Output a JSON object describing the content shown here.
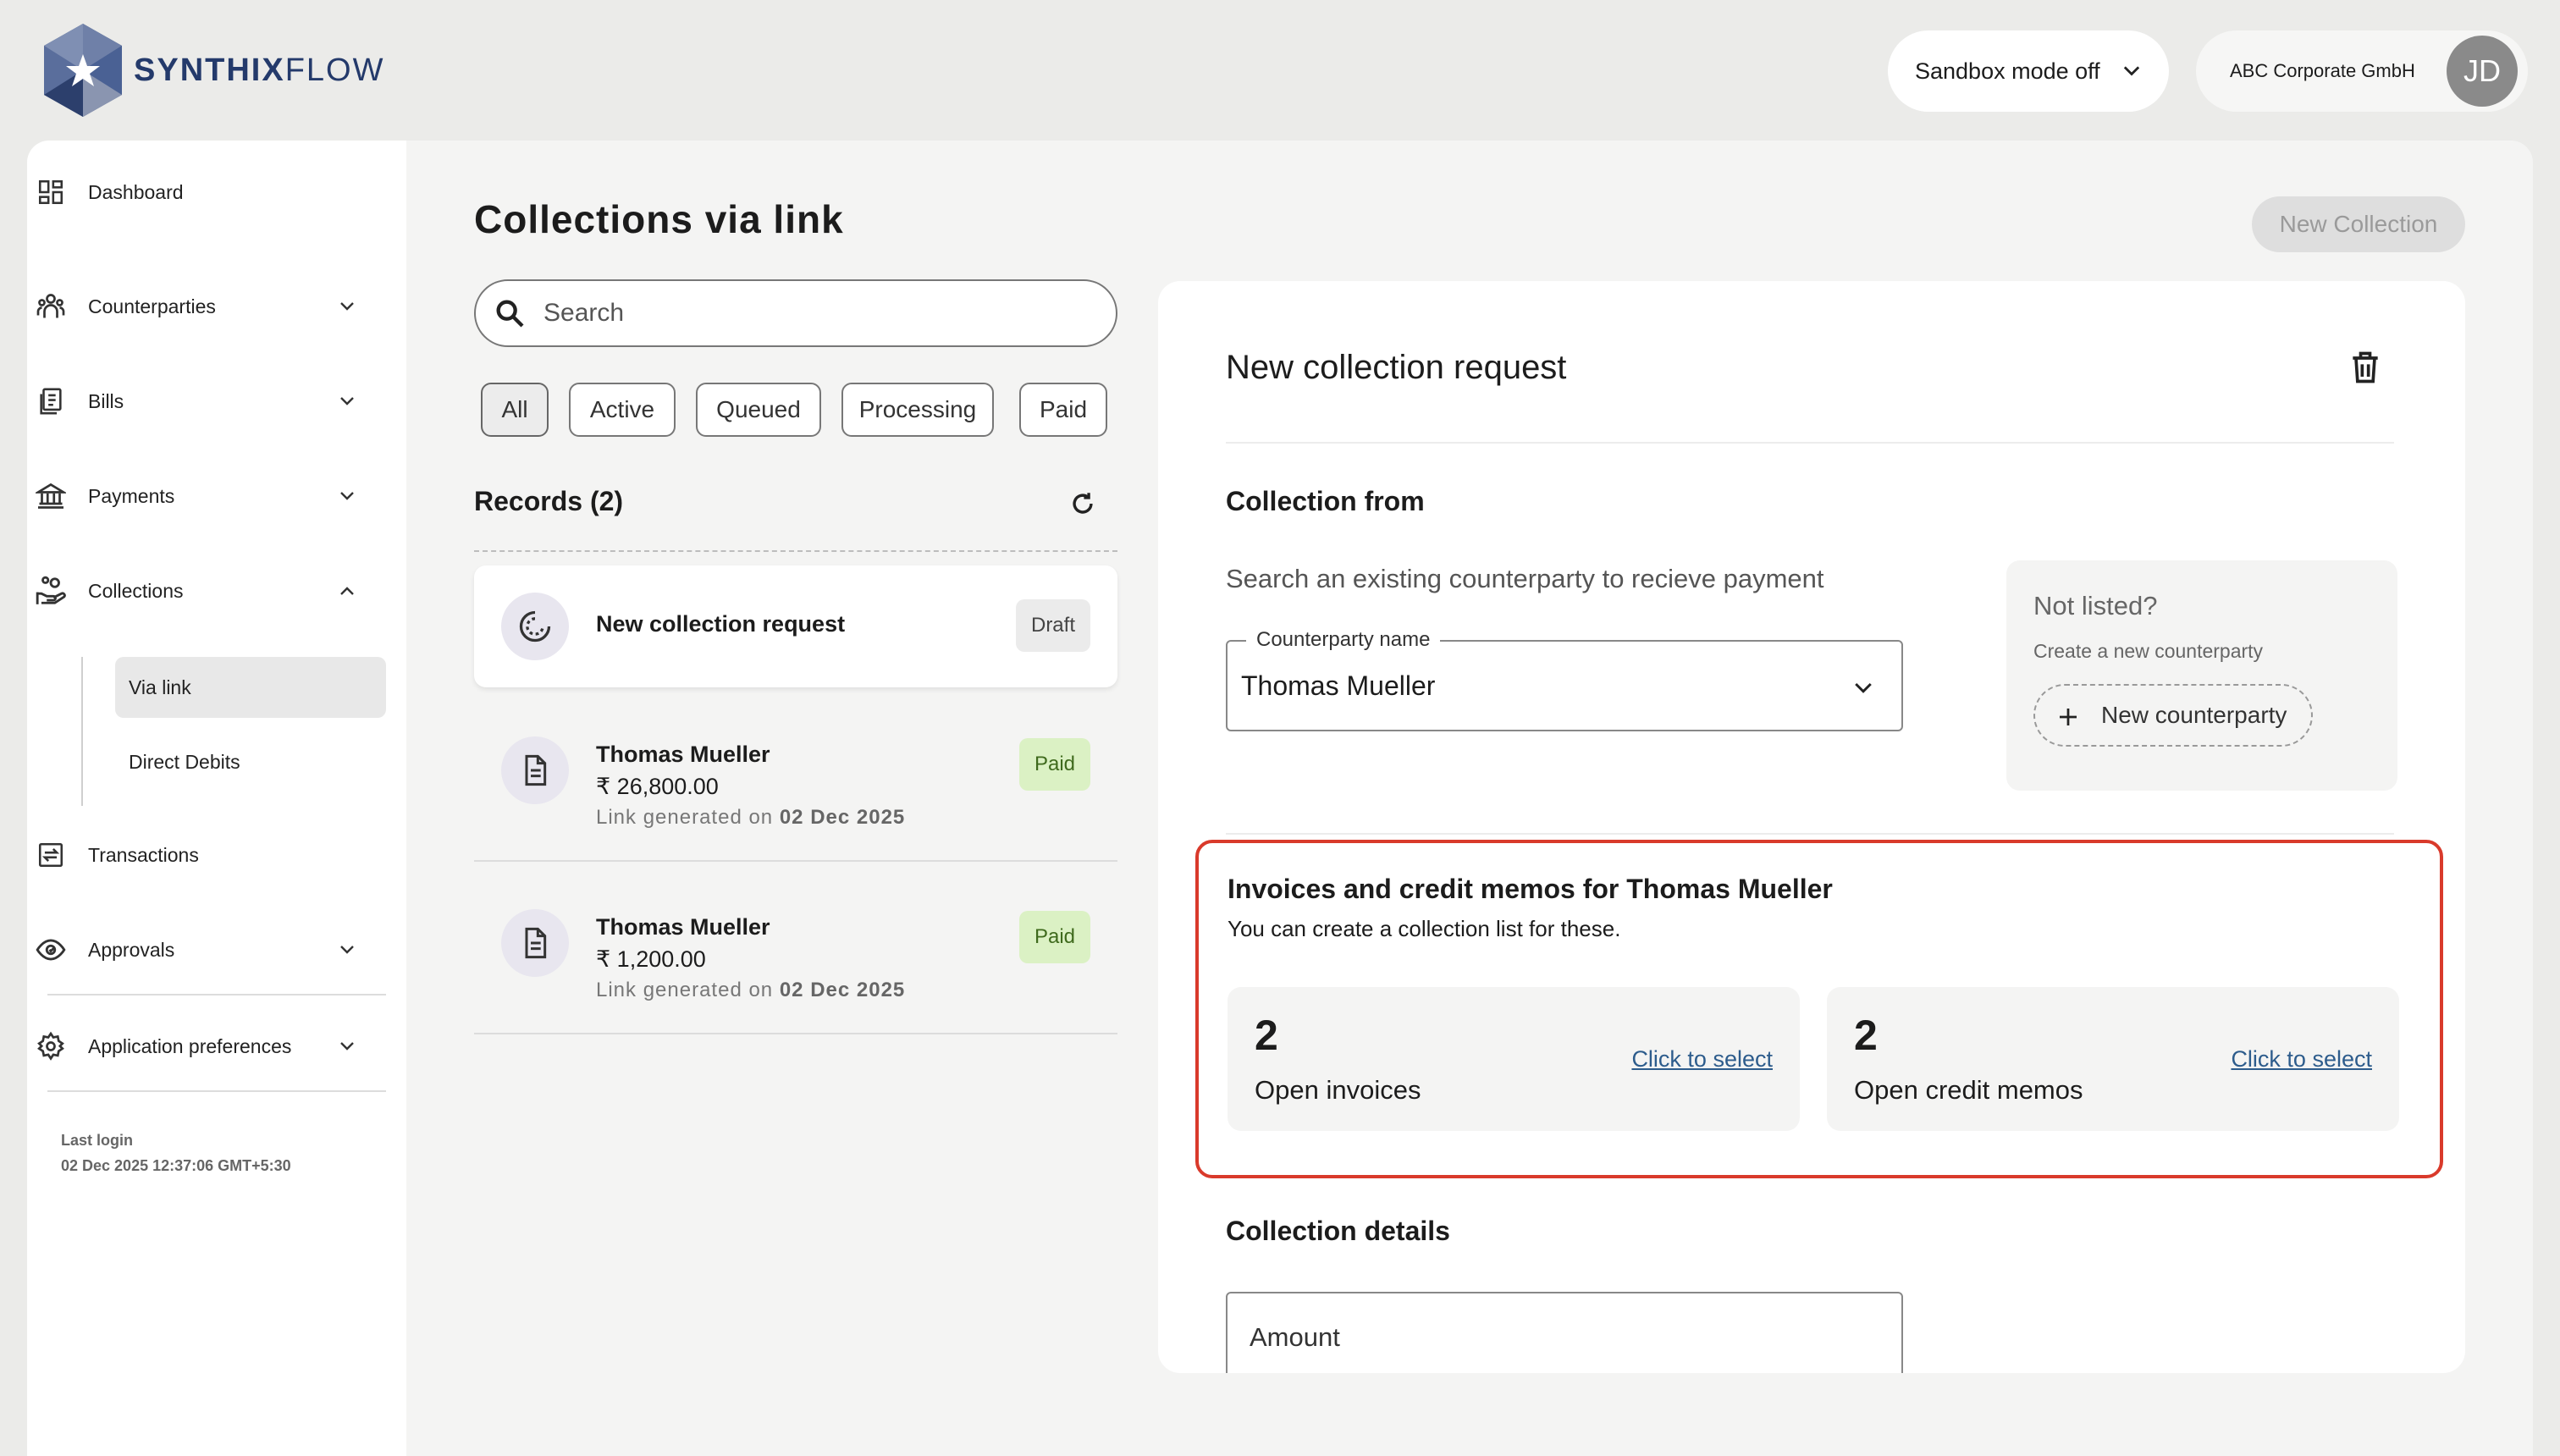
{
  "brand": {
    "name_bold": "SYNTHIX",
    "name_light": "FLOW"
  },
  "header": {
    "sandbox_label": "Sandbox mode off",
    "org_name": "ABC Corporate GmbH",
    "avatar_initials": "JD"
  },
  "sidebar": {
    "items": [
      {
        "label": "Dashboard",
        "icon": "dashboard-icon"
      },
      {
        "label": "Counterparties",
        "icon": "people-icon",
        "expandable": true
      },
      {
        "label": "Bills",
        "icon": "bills-icon",
        "expandable": true
      },
      {
        "label": "Payments",
        "icon": "bank-icon",
        "expandable": true
      },
      {
        "label": "Collections",
        "icon": "hand-coins-icon",
        "expanded": true
      },
      {
        "label": "Transactions",
        "icon": "transfer-icon"
      },
      {
        "label": "Approvals",
        "icon": "eye-icon",
        "expandable": true
      },
      {
        "label": "Application preferences",
        "icon": "gear-icon",
        "expandable": true
      }
    ],
    "sub_items": [
      {
        "label": "Via link",
        "active": true
      },
      {
        "label": "Direct Debits",
        "active": false
      }
    ],
    "last_login_label": "Last login",
    "last_login_value": "02 Dec 2025 12:37:06 GMT+5:30"
  },
  "page": {
    "title": "Collections via link",
    "new_collection_label": "New Collection",
    "search_placeholder": "Search",
    "filters": [
      "All",
      "Active",
      "Queued",
      "Processing",
      "Paid"
    ],
    "active_filter": "All",
    "records_title": "Records (2)"
  },
  "records": [
    {
      "name": "New collection request",
      "status": "Draft"
    },
    {
      "name": "Thomas Mueller",
      "amount": "₹ 26,800.00",
      "link_prefix": "Link generated on",
      "date": "02 Dec 2025",
      "status": "Paid"
    },
    {
      "name": "Thomas Mueller",
      "amount": "₹ 1,200.00",
      "link_prefix": "Link generated on",
      "date": "02 Dec 2025",
      "status": "Paid"
    }
  ],
  "form": {
    "title": "New collection request",
    "collection_from_title": "Collection from",
    "hint": "Search an existing counterparty to recieve payment",
    "counterparty_label": "Counterparty name",
    "counterparty_value": "Thomas Mueller",
    "not_listed_title": "Not listed?",
    "not_listed_sub": "Create a new counterparty",
    "new_counterparty_label": "New counterparty",
    "invoices_title": "Invoices and credit memos for Thomas Mueller",
    "invoices_sub": "You can create a collection list for these.",
    "open_invoices_count": "2",
    "open_invoices_label": "Open invoices",
    "open_credit_count": "2",
    "open_credit_label": "Open credit memos",
    "select_link_label": "Click to select",
    "details_title": "Collection details",
    "amount_label": "Amount"
  },
  "colors": {
    "brand": "#243a6b",
    "highlight_border": "#d93a2b",
    "paid_badge": "#dbf1c4",
    "link": "#2d5c8c"
  }
}
